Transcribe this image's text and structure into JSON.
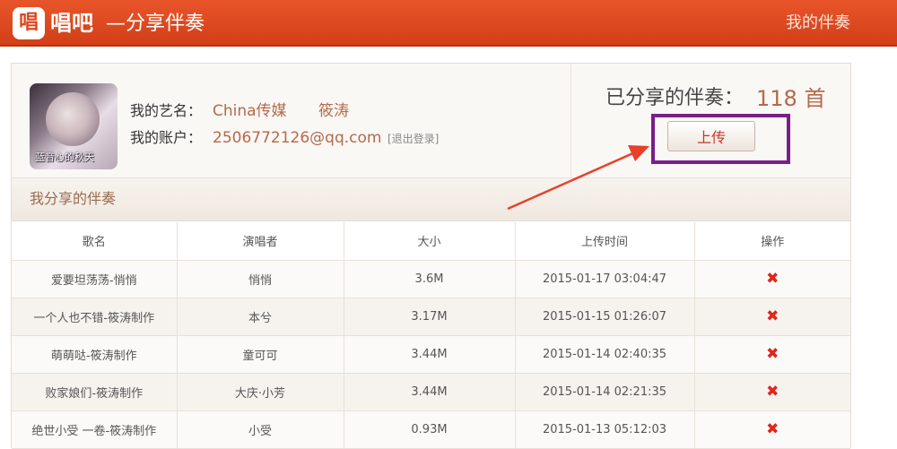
{
  "header": {
    "logo_glyph": "唱",
    "app_name": "唱吧",
    "page_subtitle": "—分享伴奏",
    "nav_right": "我的伴奏"
  },
  "profile": {
    "avatar_caption": "蓝音心的秋天",
    "stage_name_label": "我的艺名：",
    "stage_name": "China传媒",
    "stage_name_extra": "筱涛",
    "account_label": "我的账户：",
    "account": "2506772126@qq.com",
    "logout_label": "[退出登录]"
  },
  "stats": {
    "shared_label": "已分享的伴奏：",
    "shared_count": "118 首",
    "upload_label": "上传"
  },
  "section": {
    "title": "我分享的伴奏"
  },
  "table": {
    "columns": [
      "歌名",
      "演唱者",
      "大小",
      "上传时间",
      "操作"
    ],
    "rows": [
      {
        "name": "爱要坦荡荡-悄悄",
        "singer": "悄悄",
        "size": "3.6M",
        "time": "2015-01-17 03:04:47"
      },
      {
        "name": "一个人也不错-筱涛制作",
        "singer": "本兮",
        "size": "3.17M",
        "time": "2015-01-15 01:26:07"
      },
      {
        "name": "萌萌哒-筱涛制作",
        "singer": "童可可",
        "size": "3.44M",
        "time": "2015-01-14 02:40:35"
      },
      {
        "name": "败家娘们-筱涛制作",
        "singer": "大庆·小芳",
        "size": "3.44M",
        "time": "2015-01-14 02:21:35"
      },
      {
        "name": "绝世小受 一卷-筱涛制作",
        "singer": "小受",
        "size": "0.93M",
        "time": "2015-01-13 05:12:03"
      }
    ]
  },
  "colors": {
    "header_bg": "#e04a22",
    "accent_text": "#b5694a",
    "delete_icon": "#e0261e",
    "highlight_box": "#7a1e8a",
    "arrow": "#e8402a"
  }
}
